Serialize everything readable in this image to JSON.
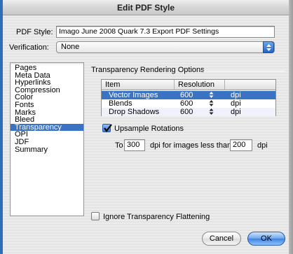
{
  "window": {
    "title": "Edit PDF Style"
  },
  "pdf_style": {
    "label": "PDF Style:",
    "value": "Imago June 2008 Quark 7.3 Export PDF Settings"
  },
  "verification": {
    "label": "Verification:",
    "value": "None"
  },
  "sidebar": {
    "items": [
      {
        "label": "Pages",
        "selected": false
      },
      {
        "label": "Meta Data",
        "selected": false
      },
      {
        "label": "Hyperlinks",
        "selected": false
      },
      {
        "label": "Compression",
        "selected": false
      },
      {
        "label": "Color",
        "selected": false
      },
      {
        "label": "Fonts",
        "selected": false
      },
      {
        "label": "Marks",
        "selected": false
      },
      {
        "label": "Bleed",
        "selected": false
      },
      {
        "label": "Transparency",
        "selected": true
      },
      {
        "label": "OPI",
        "selected": false
      },
      {
        "label": "JDF",
        "selected": false
      },
      {
        "label": "Summary",
        "selected": false
      }
    ]
  },
  "transparency": {
    "group_title": "Transparency Rendering Options",
    "table": {
      "headers": {
        "item": "Item",
        "resolution": "Resolution"
      },
      "rows": [
        {
          "item": "Vector Images",
          "resolution": "600",
          "unit": "dpi",
          "selected": true
        },
        {
          "item": "Blends",
          "resolution": "600",
          "unit": "dpi",
          "selected": false
        },
        {
          "item": "Drop Shadows",
          "resolution": "600",
          "unit": "dpi",
          "selected": false
        }
      ]
    },
    "upsample": {
      "label": "Upsample Rotations",
      "checked": true,
      "to_label": "To",
      "to_value": "300",
      "mid_label": "dpi for images less than",
      "less_value": "200",
      "unit_label": "dpi"
    },
    "ignore_flattening": {
      "label": "Ignore Transparency Flattening",
      "checked": false
    }
  },
  "buttons": {
    "cancel": "Cancel",
    "ok": "OK"
  },
  "colors": {
    "accent": "#3a73c4",
    "default_button": "#3d83e2"
  }
}
